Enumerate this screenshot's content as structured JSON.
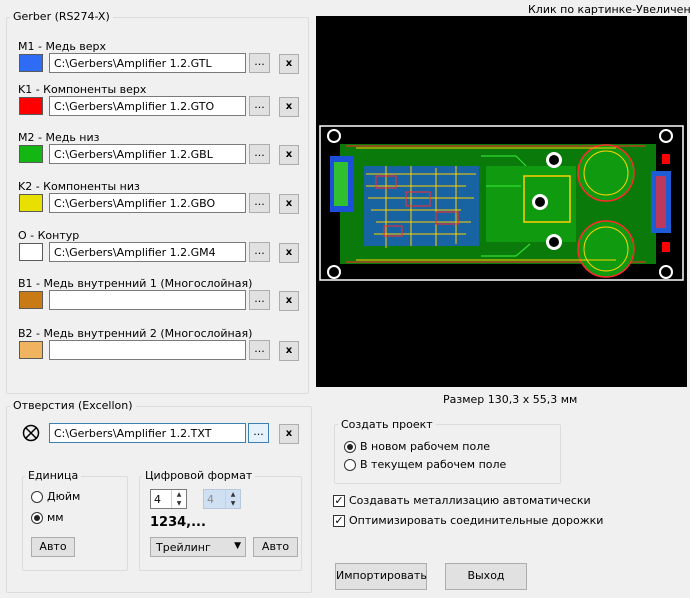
{
  "gerber": {
    "title": "Gerber (RS274-X)",
    "layers": [
      {
        "label": "M1 - Медь верх",
        "color": "#2f6cf6",
        "path": "C:\\Gerbers\\Amplifier 1.2.GTL"
      },
      {
        "label": "K1 - Компоненты верх",
        "color": "#ff0000",
        "path": "C:\\Gerbers\\Amplifier 1.2.GTO"
      },
      {
        "label": "M2 - Медь низ",
        "color": "#13b613",
        "path": "C:\\Gerbers\\Amplifier 1.2.GBL"
      },
      {
        "label": "K2 - Компоненты низ",
        "color": "#e8e000",
        "path": "C:\\Gerbers\\Amplifier 1.2.GBO"
      },
      {
        "label": "O - Контур",
        "color": "#ffffff",
        "path": "C:\\Gerbers\\Amplifier 1.2.GM4"
      },
      {
        "label": "B1 - Медь внутренний 1 (Многослойная)",
        "color": "#c87a14",
        "path": ""
      },
      {
        "label": "B2 - Медь внутренний 2 (Многослойная)",
        "color": "#f0b460",
        "path": ""
      }
    ],
    "browse_label": "...",
    "clear_label": "x"
  },
  "preview": {
    "hint": "Клик по картинке-Увеличение",
    "size_text": "Размер 130,3 x 55,3 мм"
  },
  "drill": {
    "title": "Отверстия (Excellon)",
    "path": "C:\\Gerbers\\Amplifier 1.2.TXT",
    "icon": "crosshair-circle-icon"
  },
  "units": {
    "title": "Единица",
    "options": [
      "Дюйм",
      "мм"
    ],
    "selected": "мм",
    "auto_label": "Авто"
  },
  "format": {
    "title": "Цифровой формат",
    "integer_digits": "4",
    "decimal_digits": "4",
    "sample": "1234,...",
    "zeros_mode": "Трейлинг",
    "auto_label": "Авто"
  },
  "project": {
    "title": "Создать проект",
    "options": [
      "В новом рабочем поле",
      "В текущем рабочем поле"
    ],
    "selected": "В новом рабочем поле"
  },
  "options": {
    "auto_plating": {
      "label": "Создавать металлизацию автоматически",
      "checked": true
    },
    "optimize_tracks": {
      "label": "Оптимизировать соединительные дорожки",
      "checked": true
    }
  },
  "actions": {
    "import_label": "Импортировать",
    "exit_label": "Выход"
  }
}
